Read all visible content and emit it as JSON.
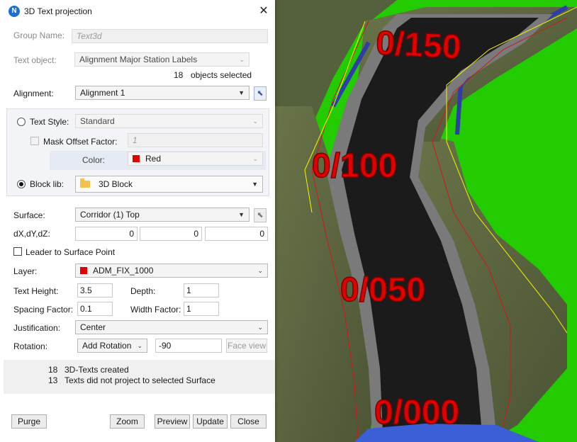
{
  "window": {
    "title": "3D Text projection",
    "app_icon_letter": "N"
  },
  "group_name": {
    "label": "Group Name:",
    "placeholder": "Text3d"
  },
  "text_object": {
    "label": "Text object:",
    "value": "Alignment Major Station Labels"
  },
  "selection": {
    "count": "18",
    "suffix": "objects selected"
  },
  "alignment": {
    "label": "Alignment:",
    "value": "Alignment 1"
  },
  "text_style": {
    "label": "Text Style:",
    "value": "Standard",
    "selected": false
  },
  "mask_offset": {
    "label": "Mask Offset Factor:",
    "value": "1",
    "checked": false
  },
  "color": {
    "label": "Color:",
    "value": "Red",
    "swatch": "#e00000"
  },
  "block_lib": {
    "label": "Block lib:",
    "value": "3D Block",
    "selected": true
  },
  "surface": {
    "label": "Surface:",
    "value": "Corridor (1) Top"
  },
  "offsets": {
    "label": "dX,dY,dZ:",
    "dx": "0",
    "dy": "0",
    "dz": "0"
  },
  "leader": {
    "label": "Leader to Surface Point",
    "checked": false
  },
  "layer": {
    "label": "Layer:",
    "value": "ADM_FIX_1000",
    "swatch": "#e00000"
  },
  "text_height": {
    "label": "Text Height:",
    "value": "3.5"
  },
  "depth": {
    "label": "Depth:",
    "value": "1"
  },
  "spacing_factor": {
    "label": "Spacing Factor:",
    "value": "0.1"
  },
  "width_factor": {
    "label": "Width Factor:",
    "value": "1"
  },
  "justification": {
    "label": "Justification:",
    "value": "Center"
  },
  "rotation": {
    "label": "Rotation:",
    "mode": "Add Rotation",
    "value": "-90",
    "face_view": "Face view"
  },
  "status": [
    {
      "count": "18",
      "text": "3D-Texts created"
    },
    {
      "count": "13",
      "text": "Texts did not project to selected Surface"
    }
  ],
  "buttons": {
    "purge": "Purge",
    "zoom": "Zoom",
    "preview": "Preview",
    "update": "Update",
    "close": "Close"
  },
  "viewport": {
    "station_labels": [
      "0/150",
      "0/100",
      "0/050",
      "0/000"
    ],
    "colors": {
      "terrain": "#22cc00",
      "slope": "#58633f",
      "road": "#1b1b1b",
      "label": "#e00000"
    }
  }
}
